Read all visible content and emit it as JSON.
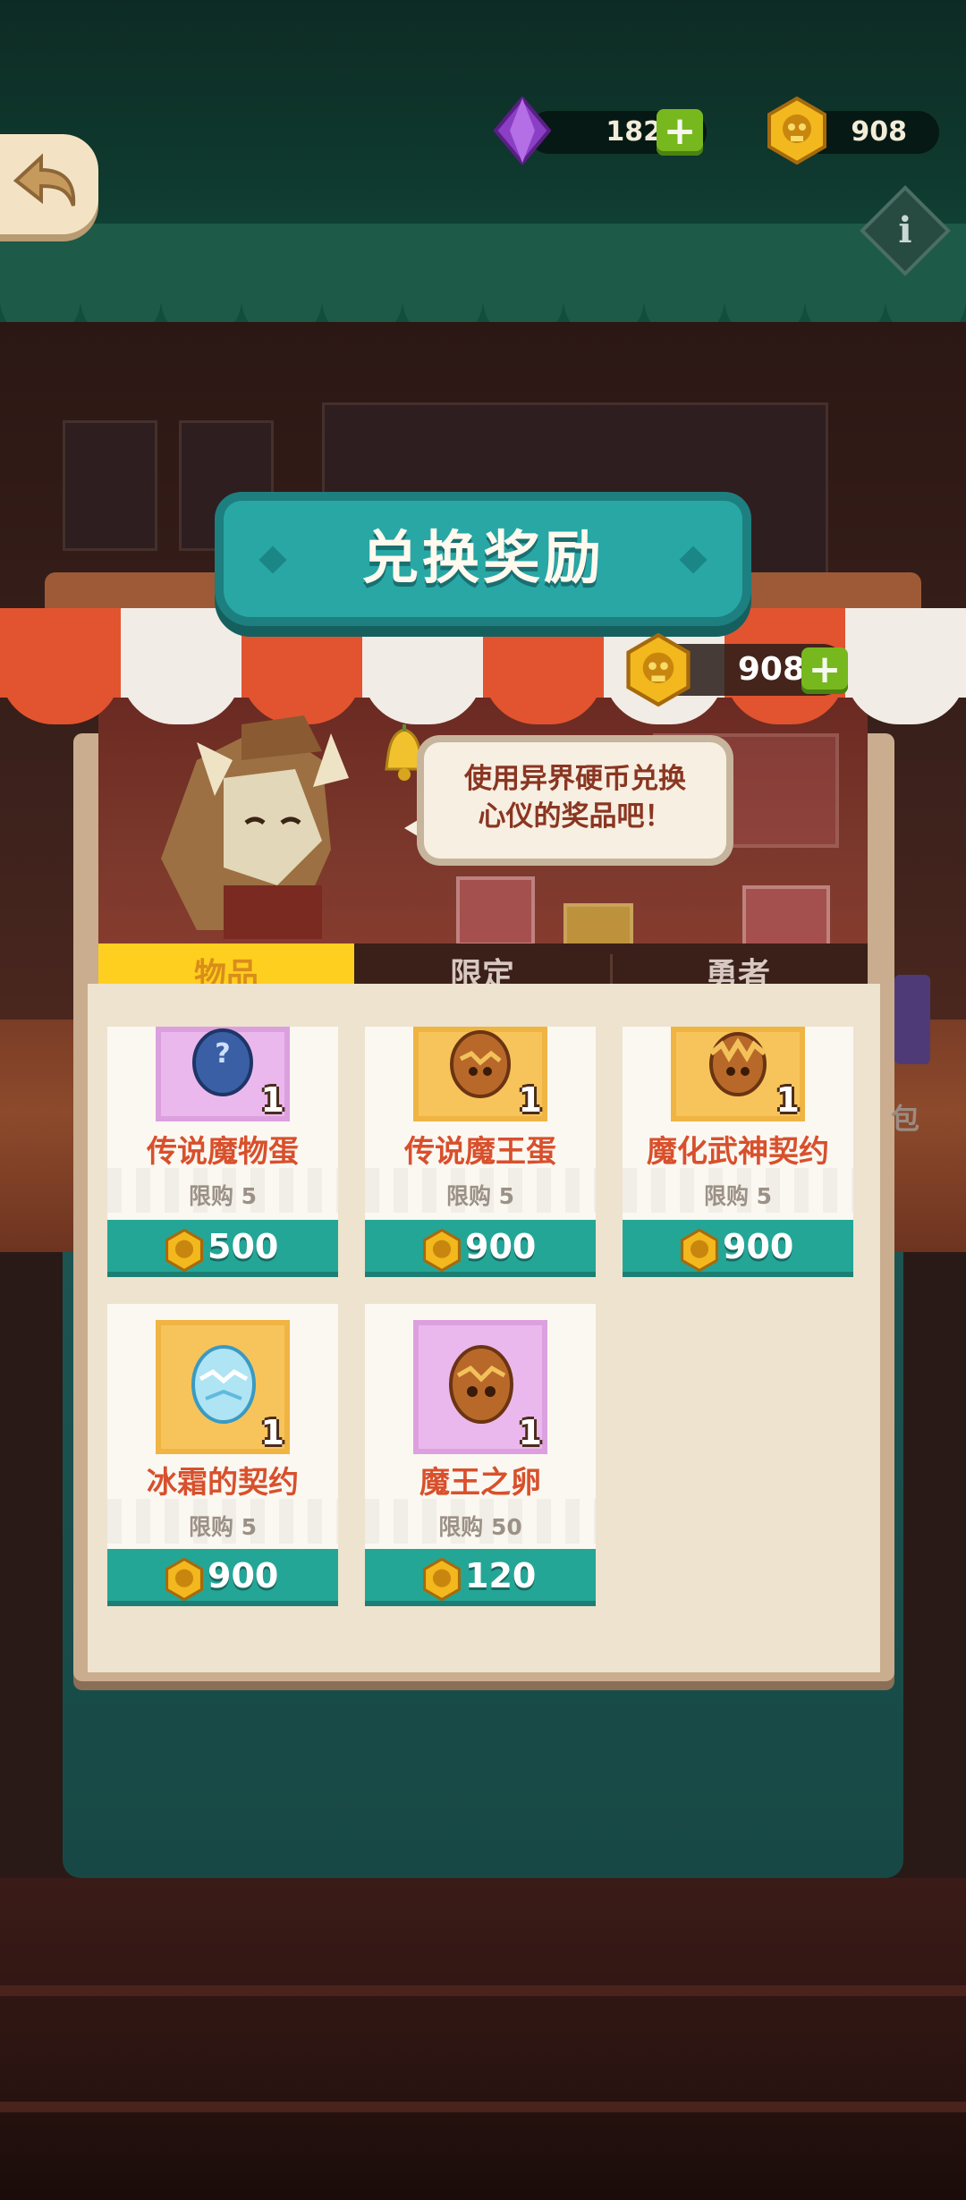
{
  "hud": {
    "gems": "182",
    "coins": "908",
    "gem_icon": "purple-gem-icon",
    "coin_icon": "skull-coin-icon",
    "add_label": "+",
    "info_label": "i"
  },
  "shop": {
    "title": "兑换奖励",
    "coins": "908",
    "add_label": "+",
    "speech": "使用异界硬币兑换\n心仪的奖品吧！",
    "tabs": [
      {
        "label": "物品",
        "active": true
      },
      {
        "label": "限定",
        "active": false
      },
      {
        "label": "勇者",
        "active": false
      }
    ],
    "items": [
      {
        "name": "传说魔物蛋",
        "limit": "限购 5",
        "price": "500",
        "qty": "1",
        "icon": "blue-mystery-egg-icon",
        "bg": "purple"
      },
      {
        "name": "传说魔王蛋",
        "limit": "限购 5",
        "price": "900",
        "qty": "1",
        "icon": "demon-king-egg-icon",
        "bg": "yellow"
      },
      {
        "name": "魔化武神契约",
        "limit": "限购 5",
        "price": "900",
        "qty": "1",
        "icon": "demon-war-god-egg-icon",
        "bg": "yellow"
      },
      {
        "name": "冰霜的契约",
        "limit": "限购 5",
        "price": "900",
        "qty": "1",
        "icon": "frost-egg-icon",
        "bg": "yellow"
      },
      {
        "name": "魔王之卵",
        "limit": "限购 50",
        "price": "120",
        "qty": "1",
        "icon": "demon-egg-icon",
        "bg": "purple"
      }
    ]
  },
  "side": {
    "bag_label": "包"
  },
  "colors": {
    "teal": "#24a697",
    "tab_active": "#ffcf1f",
    "item_name": "#d8502c",
    "awning_red": "#e1542f"
  }
}
